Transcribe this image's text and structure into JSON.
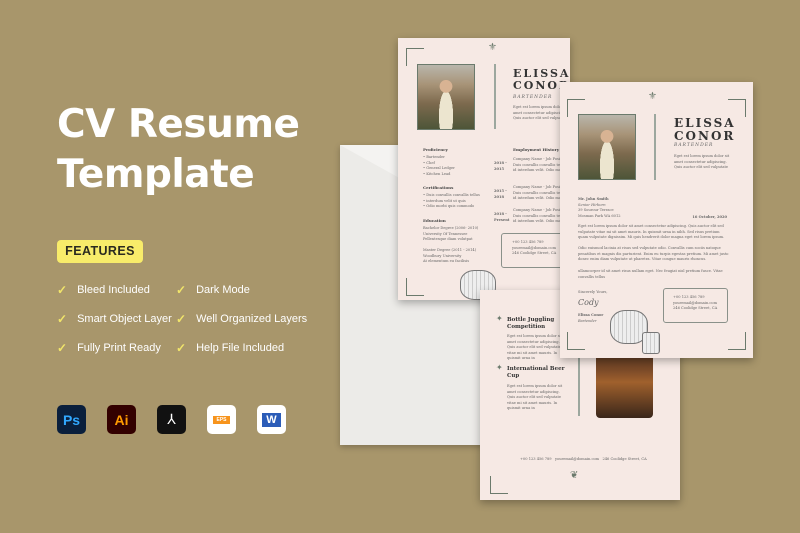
{
  "title": {
    "line1": "CV Resume",
    "line2": "Template"
  },
  "features": {
    "label": "FEATURES",
    "items": [
      "Bleed Included",
      "Dark Mode",
      "Smart Object Layer",
      "Well Organized Layers",
      "Fully Print Ready",
      "Help File Included"
    ]
  },
  "apps": [
    {
      "name": "photoshop-icon",
      "label": "Ps"
    },
    {
      "name": "illustrator-icon",
      "label": "Ai"
    },
    {
      "name": "acrobat-icon",
      "label": "⅄"
    },
    {
      "name": "eps-file-icon",
      "label": "EPS"
    },
    {
      "name": "word-icon",
      "label": "W"
    }
  ],
  "colors": {
    "background": "#a8966b",
    "badge": "#f8ec6a",
    "check": "#f1e56a",
    "paper": "#f6e9e4"
  },
  "resume": {
    "first": "ELISSA",
    "last": "CONOR",
    "role": "BARTENDER",
    "intro": "Eget est lorem ipsum dolor sit amet consectetur adipiscing. Quis auctor elit sed vulputate",
    "proficiency_h": "Proficiency",
    "proficiency": [
      "• Bartender",
      "• Chef",
      "• General Ledger",
      "• Kitchen Lead"
    ],
    "cert_h": "Certifications",
    "certs": [
      "• Duis convallis convallis tellus",
      "• interdum velit ut quis",
      "• Odio morbi quis commodo"
    ],
    "edu_h": "Education",
    "edu": [
      "Bachelor Degree (2006- 2010)",
      "University Of Tennessee",
      "Pellentesque diam volutpat",
      "",
      "Master Degree (2011 - 2014)",
      "Woodbury University",
      "At elementum eu facilisis"
    ],
    "emp_h": "Employment History",
    "years": [
      "2018 -\n2015",
      "2015 -\n2018",
      "2018 -\nPresent"
    ],
    "job": "Company Name - Job Position\nDuis convallis convallis tellus\nid interdum velit. Odio morbi",
    "contact": [
      "+00 123 456 789",
      "youremail@domain.com",
      "246 Coolidge Street, CA"
    ]
  },
  "letter": {
    "recipient": [
      "Mr. John Smith",
      "Senior Hirborn",
      "39 Sourour Terrace",
      "Mosman Park WA 6012"
    ],
    "date": "16 October, 2020",
    "p1": "Eget est lorem ipsum dolor sit amet consectetur adipiscing. Quis auctor elit sed vulputate vitae mi sit amet mauris. In quismit urna in nibh. Sed risus pretium quam vulputate dignissim. Mi quis hendrerit dolor magna eget est lorem ipsum.",
    "p2": "Odio euismod lacinia at risus sed vulputate odio. Convallis cum sociis natoque penatibus et magnis dis parturient. Enim eu turpis egestas pretium. Mi amet justo donec enim diam vulputate ut pharetra. Vitae congue mauris rhoncus.",
    "p3": "ullamcorper id sit amet risus nullam eget. Nec feugiat nisl pretium fusce. Vitae convallis tellus",
    "closing": "Sincerely Yours,",
    "signature": "Cody",
    "name": "Elissa Conor",
    "role": "Bartender"
  },
  "portfolio": {
    "items": [
      {
        "title": "Bottle Juggling Competition",
        "text": "Eget est lorem ipsum dolor sit amet consectetur adipiscing. Quis auctor elit sed vulputate vitae mi sit amet mauris. In quismit urna in"
      },
      {
        "title": "International Beer Cup",
        "text": "Eget est lorem ipsum dolor sit amet consectetur adipiscing. Quis auctor elit sed vulputate vitae mi sit amet mauris. In quismit urna in"
      }
    ]
  }
}
